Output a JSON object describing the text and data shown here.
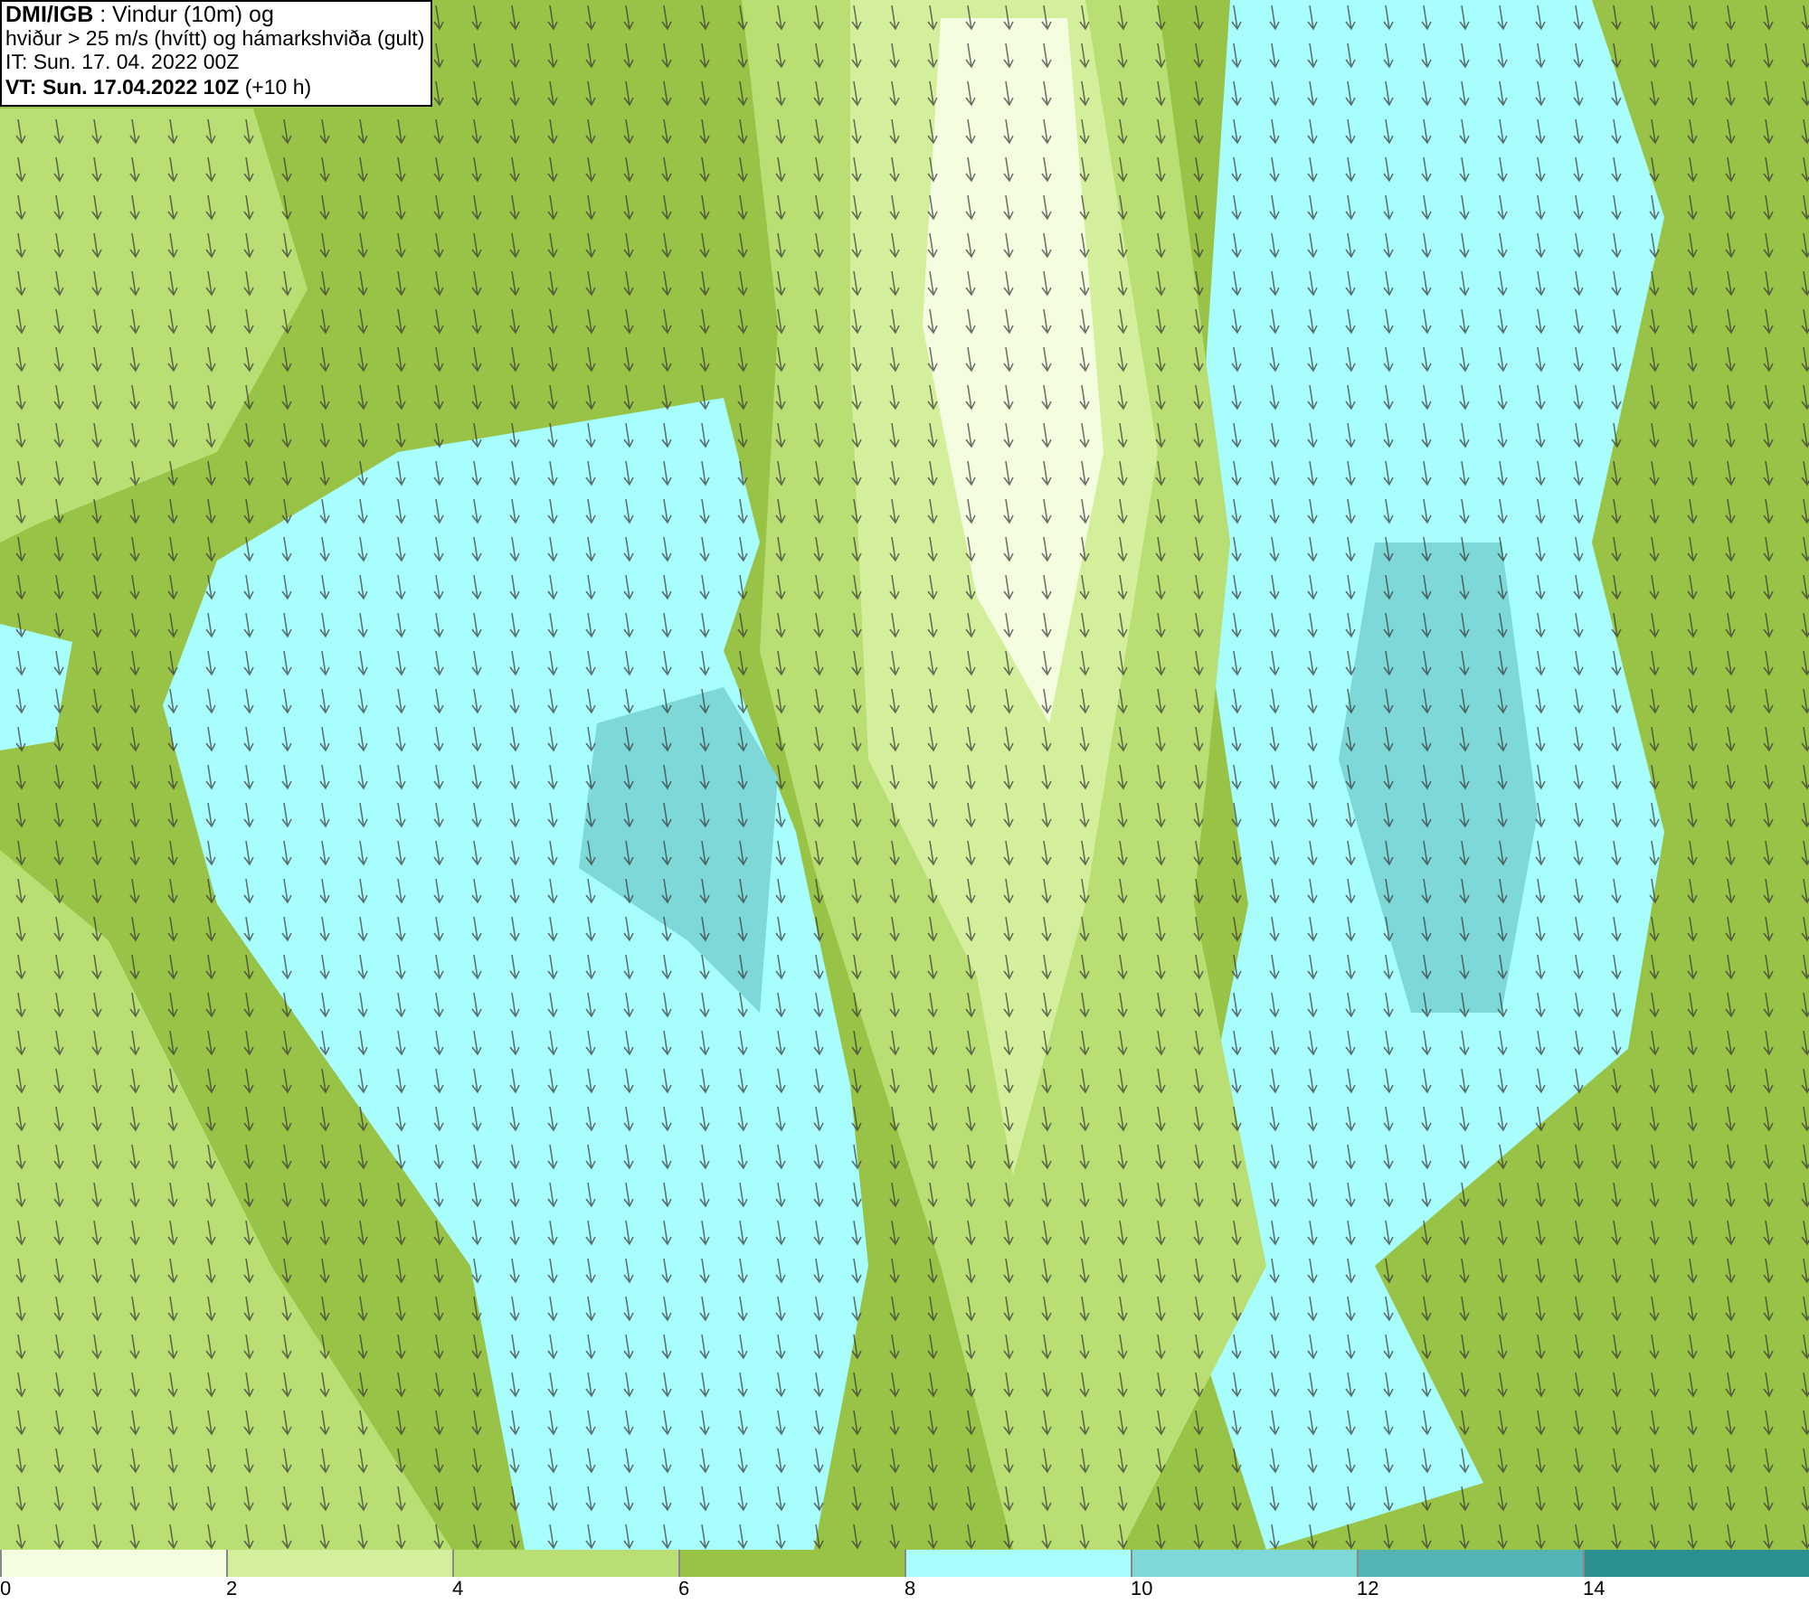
{
  "header": {
    "lines": [
      "**DMI/IGB** : Vindur (10m) og",
      "hviður > 25 m/s (hvítt) og hámarkshviða (gult)",
      "IT: Sun. 17. 04. 2022 00Z",
      "**VT: Sun. 17.04.2022 10Z** (+10 h)"
    ]
  },
  "legend": [
    {
      "label": "0",
      "color": "#f4fde0"
    },
    {
      "label": "2",
      "color": "#d4ef9b"
    },
    {
      "label": "4",
      "color": "#b8de74"
    },
    {
      "label": "6",
      "color": "#98c347"
    },
    {
      "label": "8",
      "color": "#a8fdfd"
    },
    {
      "label": "10",
      "color": "#7fd8d8"
    },
    {
      "label": "12",
      "color": "#54b3b3"
    },
    {
      "label": "14",
      "color": "#2a9090"
    }
  ]
}
